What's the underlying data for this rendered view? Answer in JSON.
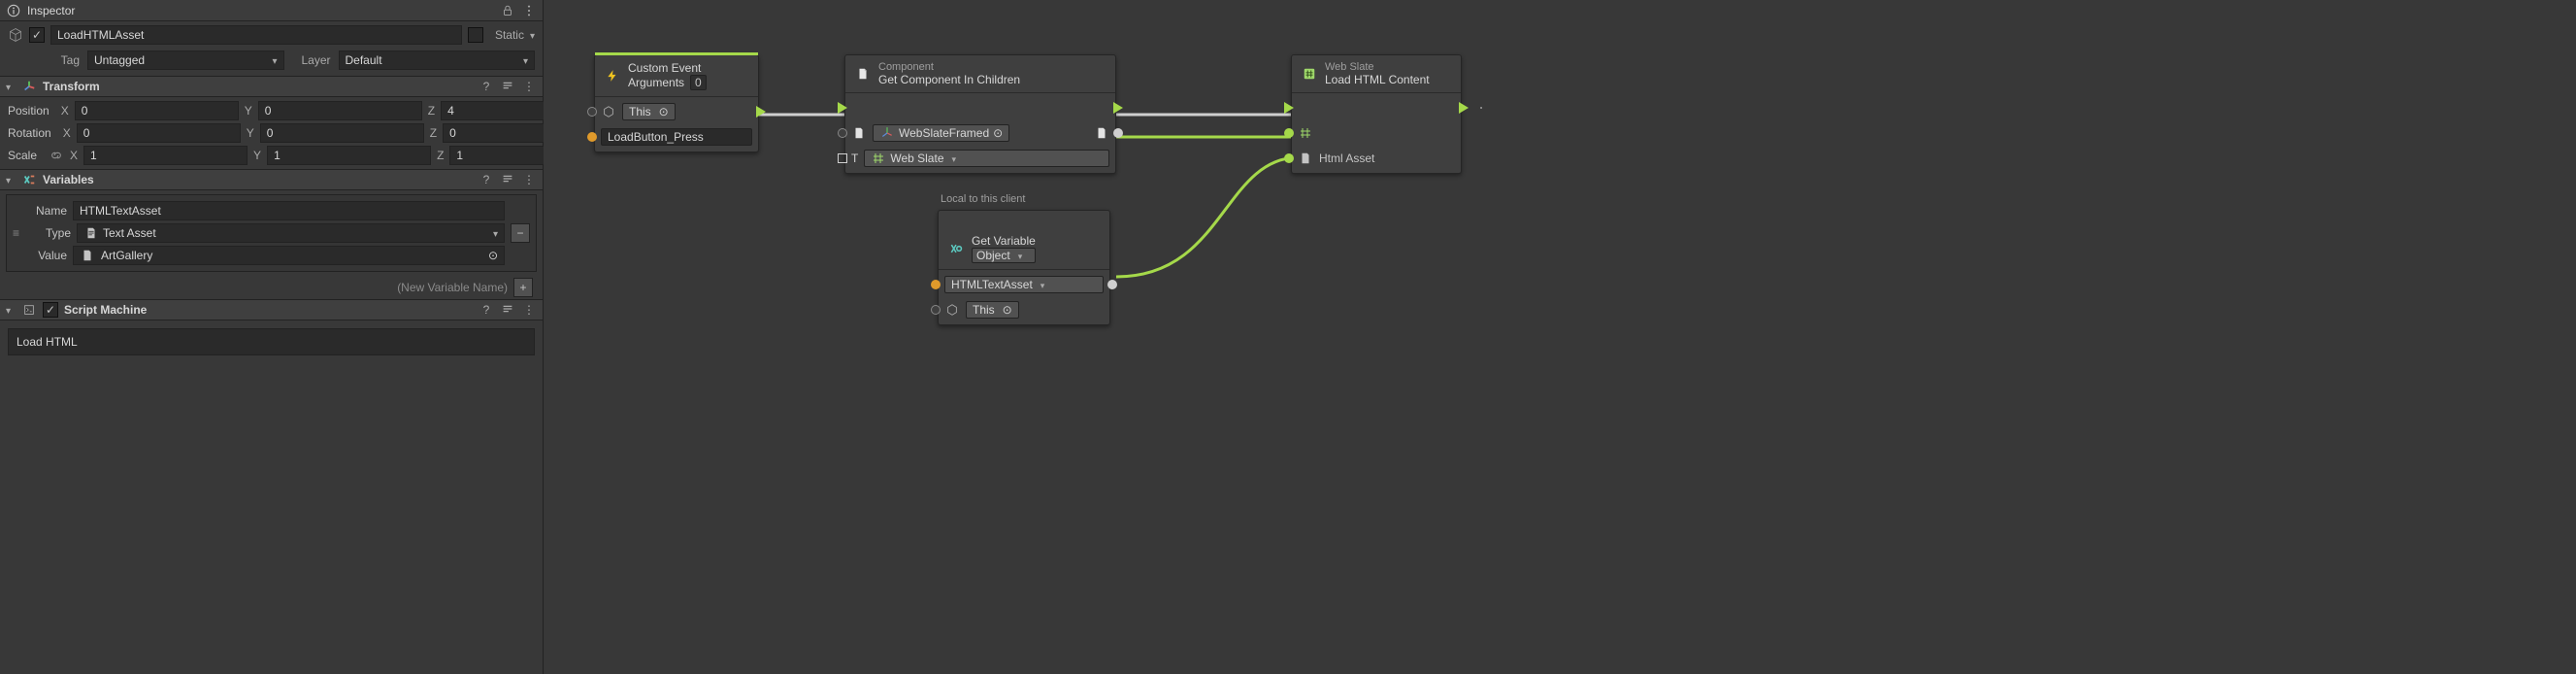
{
  "inspector": {
    "panel_title": "Inspector",
    "go_name": "LoadHTMLAsset",
    "static_label": "Static",
    "tag_label": "Tag",
    "tag_value": "Untagged",
    "layer_label": "Layer",
    "layer_value": "Default"
  },
  "transform": {
    "title": "Transform",
    "position_label": "Position",
    "position": {
      "x": "0",
      "y": "0",
      "z": "4"
    },
    "rotation_label": "Rotation",
    "rotation": {
      "x": "0",
      "y": "0",
      "z": "0"
    },
    "scale_label": "Scale",
    "scale": {
      "x": "1",
      "y": "1",
      "z": "1"
    }
  },
  "variables": {
    "title": "Variables",
    "name_label": "Name",
    "name_value": "HTMLTextAsset",
    "type_label": "Type",
    "type_value": "Text Asset",
    "value_label": "Value",
    "value_value": "ArtGallery",
    "new_hint": "(New Variable Name)"
  },
  "script_machine": {
    "title": "Script Machine",
    "graph_name": "Load HTML"
  },
  "nodes": {
    "custom_event": {
      "title_line1": "Custom Event",
      "title_line2": "Arguments",
      "args_count": "0",
      "target_value": "This",
      "event_name": "LoadButton_Press"
    },
    "get_component": {
      "category": "Component",
      "title": "Get Component In Children",
      "target_value": "WebSlateFramed",
      "type_prefix": "T",
      "type_value": "Web Slate"
    },
    "get_variable": {
      "scope_label": "Local to this client",
      "title": "Get Variable",
      "kind": "Object",
      "var_name": "HTMLTextAsset",
      "target_value": "This"
    },
    "load_html": {
      "category": "Web Slate",
      "title": "Load HTML Content",
      "port_label": "Html Asset"
    }
  }
}
